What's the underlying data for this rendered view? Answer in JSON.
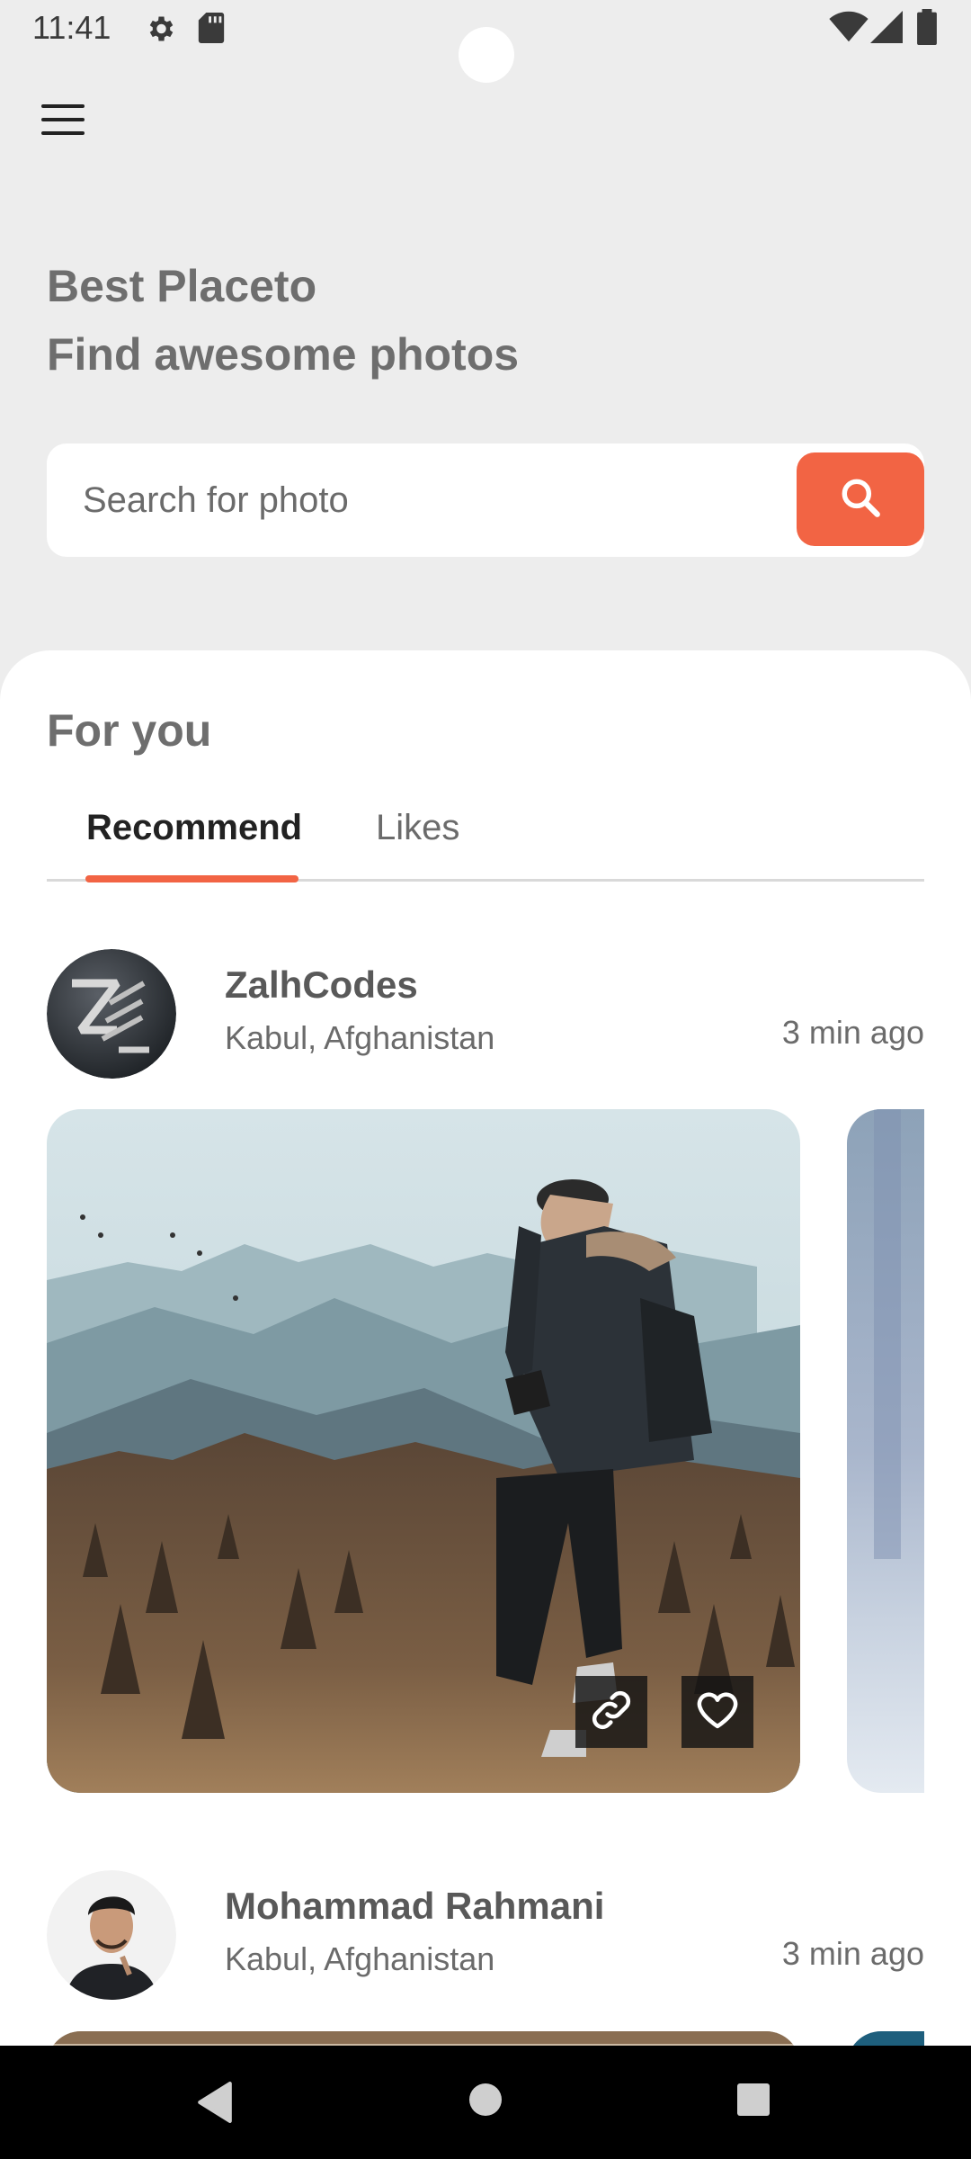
{
  "status_bar": {
    "time": "11:41",
    "icons": [
      "settings-icon",
      "sd-card-icon",
      "wifi-icon",
      "signal-icon",
      "battery-icon"
    ]
  },
  "header": {
    "menu_icon": "hamburger-menu-icon",
    "headline_line1": "Best Placeto",
    "headline_line2": "Find awesome photos"
  },
  "search": {
    "placeholder": "Search for photo",
    "button_icon": "search-icon"
  },
  "feed": {
    "section_title": "For you",
    "tabs": [
      {
        "label": "Recommend",
        "active": true
      },
      {
        "label": "Likes",
        "active": false
      }
    ],
    "posts": [
      {
        "author": "ZalhCodes",
        "location": "Kabul, Afghanistan",
        "time": "3 min ago",
        "avatar": "zalhcodes-logo-avatar",
        "actions": [
          "link-icon",
          "heart-icon"
        ]
      },
      {
        "author": "Mohammad Rahmani",
        "location": "Kabul, Afghanistan",
        "time": "3 min ago",
        "avatar": "person-avatar"
      }
    ]
  },
  "colors": {
    "accent": "#f26444",
    "background": "#ededed",
    "sheet": "#ffffff"
  },
  "nav_bar": {
    "buttons": [
      "back-icon",
      "home-icon",
      "recents-icon"
    ]
  }
}
